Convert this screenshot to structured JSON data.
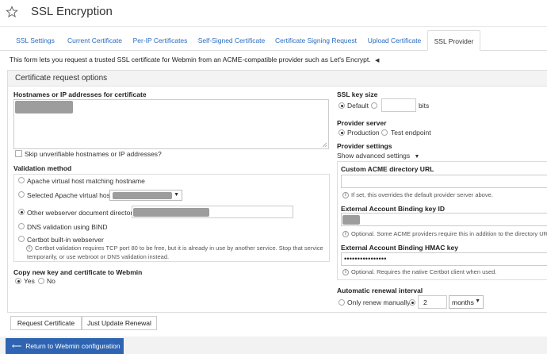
{
  "header": {
    "title": "SSL Encryption",
    "star_icon": "star-outline-icon"
  },
  "tabs": [
    {
      "label": "SSL Settings"
    },
    {
      "label": "Current Certificate"
    },
    {
      "label": "Per-IP Certificates"
    },
    {
      "label": "Self-Signed Certificate"
    },
    {
      "label": "Certificate Signing Request"
    },
    {
      "label": "Upload Certificate"
    },
    {
      "label": "SSL Provider",
      "active": true
    }
  ],
  "intro": "This form lets you request a trusted SSL certificate for Webmin from an ACME-compatible provider such as Let's Encrypt.",
  "panel_title": "Certificate request options",
  "hostnames": {
    "label": "Hostnames or IP addresses for certificate",
    "skip_label": "Skip unverifiable hostnames or IP addresses?"
  },
  "validation": {
    "label": "Validation method",
    "options": {
      "apache_match": "Apache virtual host matching hostname",
      "apache_selected": "Selected Apache virtual host",
      "other_docroot": "Other webserver document directory",
      "dns_bind": "DNS validation using BIND",
      "certbot": "Certbot built-in webserver"
    },
    "certbot_note_1": "Certbot validation requires TCP port 80 to be free, but it is already in use by another service. Stop that service",
    "certbot_note_2": "temporarily, or use webroot or DNS validation instead."
  },
  "copy_key": {
    "label": "Copy new key and certificate to Webmin",
    "yes": "Yes",
    "no": "No"
  },
  "key_size": {
    "label": "SSL key size",
    "default": "Default",
    "unit": "bits"
  },
  "provider_server": {
    "label": "Provider server",
    "production": "Production",
    "test": "Test endpoint"
  },
  "provider_settings": {
    "label": "Provider settings",
    "toggle": "Show advanced settings",
    "custom_dir_label": "Custom ACME directory URL",
    "custom_dir_help": "If set, this overrides the default provider server above.",
    "eab_key_label": "External Account Binding key ID",
    "eab_key_help": "Optional. Some ACME providers require this in addition to the directory URL.",
    "eab_hmac_label": "External Account Binding HMAC key",
    "eab_hmac_value": "••••••••••••••••",
    "eab_hmac_help": "Optional. Requires the native Certbot client when used."
  },
  "renewal": {
    "label": "Automatic renewal interval",
    "manual": "Only renew manually",
    "interval_value": "2",
    "unit": "months"
  },
  "buttons": {
    "request": "Request Certificate",
    "update": "Just Update Renewal"
  },
  "back_button": "Return to Webmin configuration"
}
